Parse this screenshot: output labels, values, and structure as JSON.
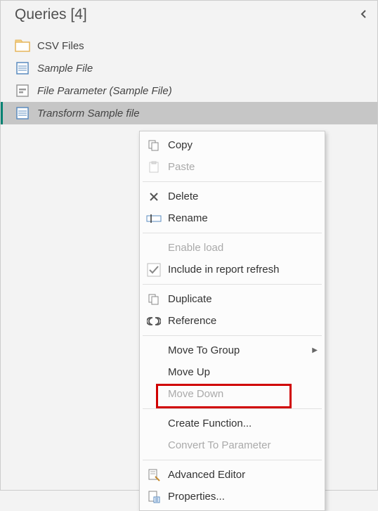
{
  "panel": {
    "title": "Queries [4]"
  },
  "queries": [
    {
      "label": "CSV Files",
      "icon": "folder",
      "italic": false,
      "selected": false
    },
    {
      "label": "Sample File",
      "icon": "sheet",
      "italic": true,
      "selected": false
    },
    {
      "label": "File Parameter (Sample File)",
      "icon": "param",
      "italic": true,
      "selected": false
    },
    {
      "label": "Transform Sample file",
      "icon": "sheet",
      "italic": true,
      "selected": true
    }
  ],
  "menu": {
    "copy": "Copy",
    "paste": "Paste",
    "delete": "Delete",
    "rename": "Rename",
    "enable_load": "Enable load",
    "include_refresh": "Include in report refresh",
    "duplicate": "Duplicate",
    "reference": "Reference",
    "move_to_group": "Move To Group",
    "move_up": "Move Up",
    "move_down": "Move Down",
    "create_function": "Create Function...",
    "convert_to_parameter": "Convert To Parameter",
    "advanced_editor": "Advanced Editor",
    "properties": "Properties..."
  }
}
